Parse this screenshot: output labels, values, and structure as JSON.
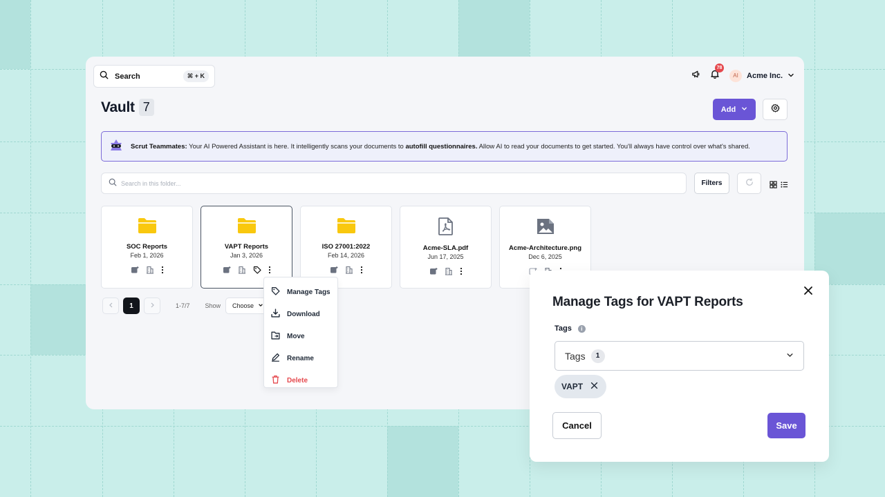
{
  "header": {
    "search_label": "Search",
    "shortcut": "⌘ + K",
    "notification_count": "78",
    "avatar_initials": "AI",
    "org_name": "Acme Inc."
  },
  "page": {
    "title": "Vault",
    "count": "7",
    "add_label": "Add"
  },
  "banner": {
    "prefix": "Scrut Teammates:",
    "text1": " Your AI Powered Assistant is here. It intelligently scans your documents to ",
    "bold": "autofill questionnaires.",
    "text2": " Allow AI to read your documents to get started. You'll always have control over what's shared."
  },
  "toolbar": {
    "search_placeholder": "Search in this folder...",
    "filters_label": "Filters"
  },
  "items": [
    {
      "name": "SOC Reports",
      "date": "Feb 1, 2026",
      "type": "folder"
    },
    {
      "name": "VAPT Reports",
      "date": "Jan 3, 2026",
      "type": "folder"
    },
    {
      "name": "ISO 27001:2022",
      "date": "Feb 14, 2026",
      "type": "folder"
    },
    {
      "name": "Acme-SLA.pdf",
      "date": "Jun 17, 2025",
      "type": "pdf"
    },
    {
      "name": "Acme-Architecture.png",
      "date": "Dec 6, 2025",
      "type": "image"
    }
  ],
  "pagination": {
    "current": "1",
    "range": "1-7/7",
    "show_label": "Show",
    "select_value": "Choose"
  },
  "context_menu": {
    "manage_tags": "Manage Tags",
    "download": "Download",
    "move": "Move",
    "rename": "Rename",
    "delete": "Delete"
  },
  "modal": {
    "title": "Manage Tags for VAPT Reports",
    "tags_label": "Tags",
    "select_label": "Tags",
    "select_count": "1",
    "tag": "VAPT",
    "cancel": "Cancel",
    "save": "Save"
  },
  "colors": {
    "accent": "#6a55d6",
    "folder": "#f9c80e",
    "danger": "#e5484d",
    "background": "#c9eeea"
  }
}
